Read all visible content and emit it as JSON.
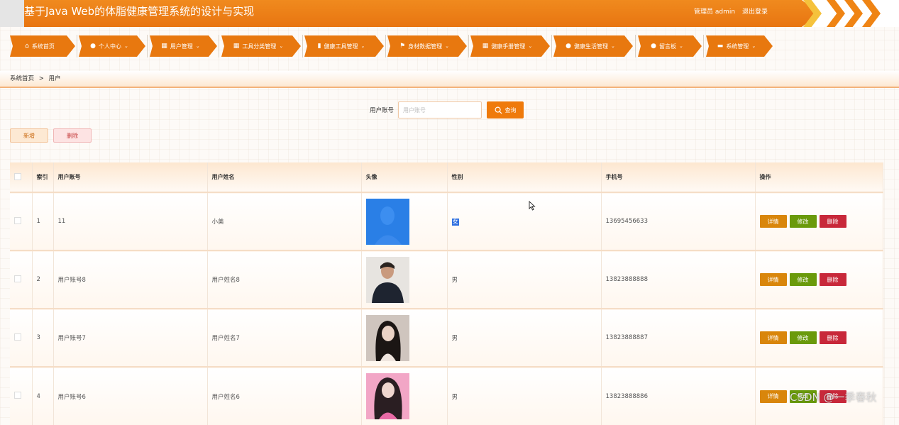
{
  "header": {
    "title": "基于Java Web的体脂健康管理系统的设计与实现",
    "user": "管理员 admin",
    "logout": "退出登录"
  },
  "nav": [
    {
      "label": "系统首页",
      "icon": "home-icon"
    },
    {
      "label": "个人中心",
      "icon": "user-icon"
    },
    {
      "label": "用户管理",
      "icon": "grid-icon"
    },
    {
      "label": "工具分类管理",
      "icon": "grid-icon"
    },
    {
      "label": "健康工具管理",
      "icon": "bar-chart-icon"
    },
    {
      "label": "身材数据管理",
      "icon": "flag-icon"
    },
    {
      "label": "健康手册管理",
      "icon": "grid-icon"
    },
    {
      "label": "健康生活管理",
      "icon": "user-icon"
    },
    {
      "label": "留言板",
      "icon": "bell-icon"
    },
    {
      "label": "系统管理",
      "icon": "database-icon"
    }
  ],
  "breadcrumb": {
    "home": "系统首页",
    "sep": ">",
    "current": "用户"
  },
  "search": {
    "label": "用户账号",
    "placeholder": "用户账号",
    "button": "查询"
  },
  "actions": {
    "add": "新增",
    "delete": "删除"
  },
  "table": {
    "headers": {
      "index": "索引",
      "account": "用户账号",
      "name": "用户姓名",
      "avatar": "头像",
      "gender": "性别",
      "phone": "手机号",
      "ops": "操作"
    },
    "op_labels": {
      "detail": "详情",
      "edit": "修改",
      "delete": "删除"
    },
    "rows": [
      {
        "index": "1",
        "account": "11",
        "name": "小美",
        "gender": "女",
        "phone": "13695456633"
      },
      {
        "index": "2",
        "account": "用户账号8",
        "name": "用户姓名8",
        "gender": "男",
        "phone": "13823888888"
      },
      {
        "index": "3",
        "account": "用户账号7",
        "name": "用户姓名7",
        "gender": "男",
        "phone": "13823888887"
      },
      {
        "index": "4",
        "account": "用户账号6",
        "name": "用户姓名6",
        "gender": "男",
        "phone": "13823888886"
      }
    ]
  },
  "watermark": "CSDN @一季春秋",
  "colors": {
    "brand": "#e8780f",
    "detail": "#d9860b",
    "edit": "#6a9a0b",
    "delete": "#c8283a"
  }
}
